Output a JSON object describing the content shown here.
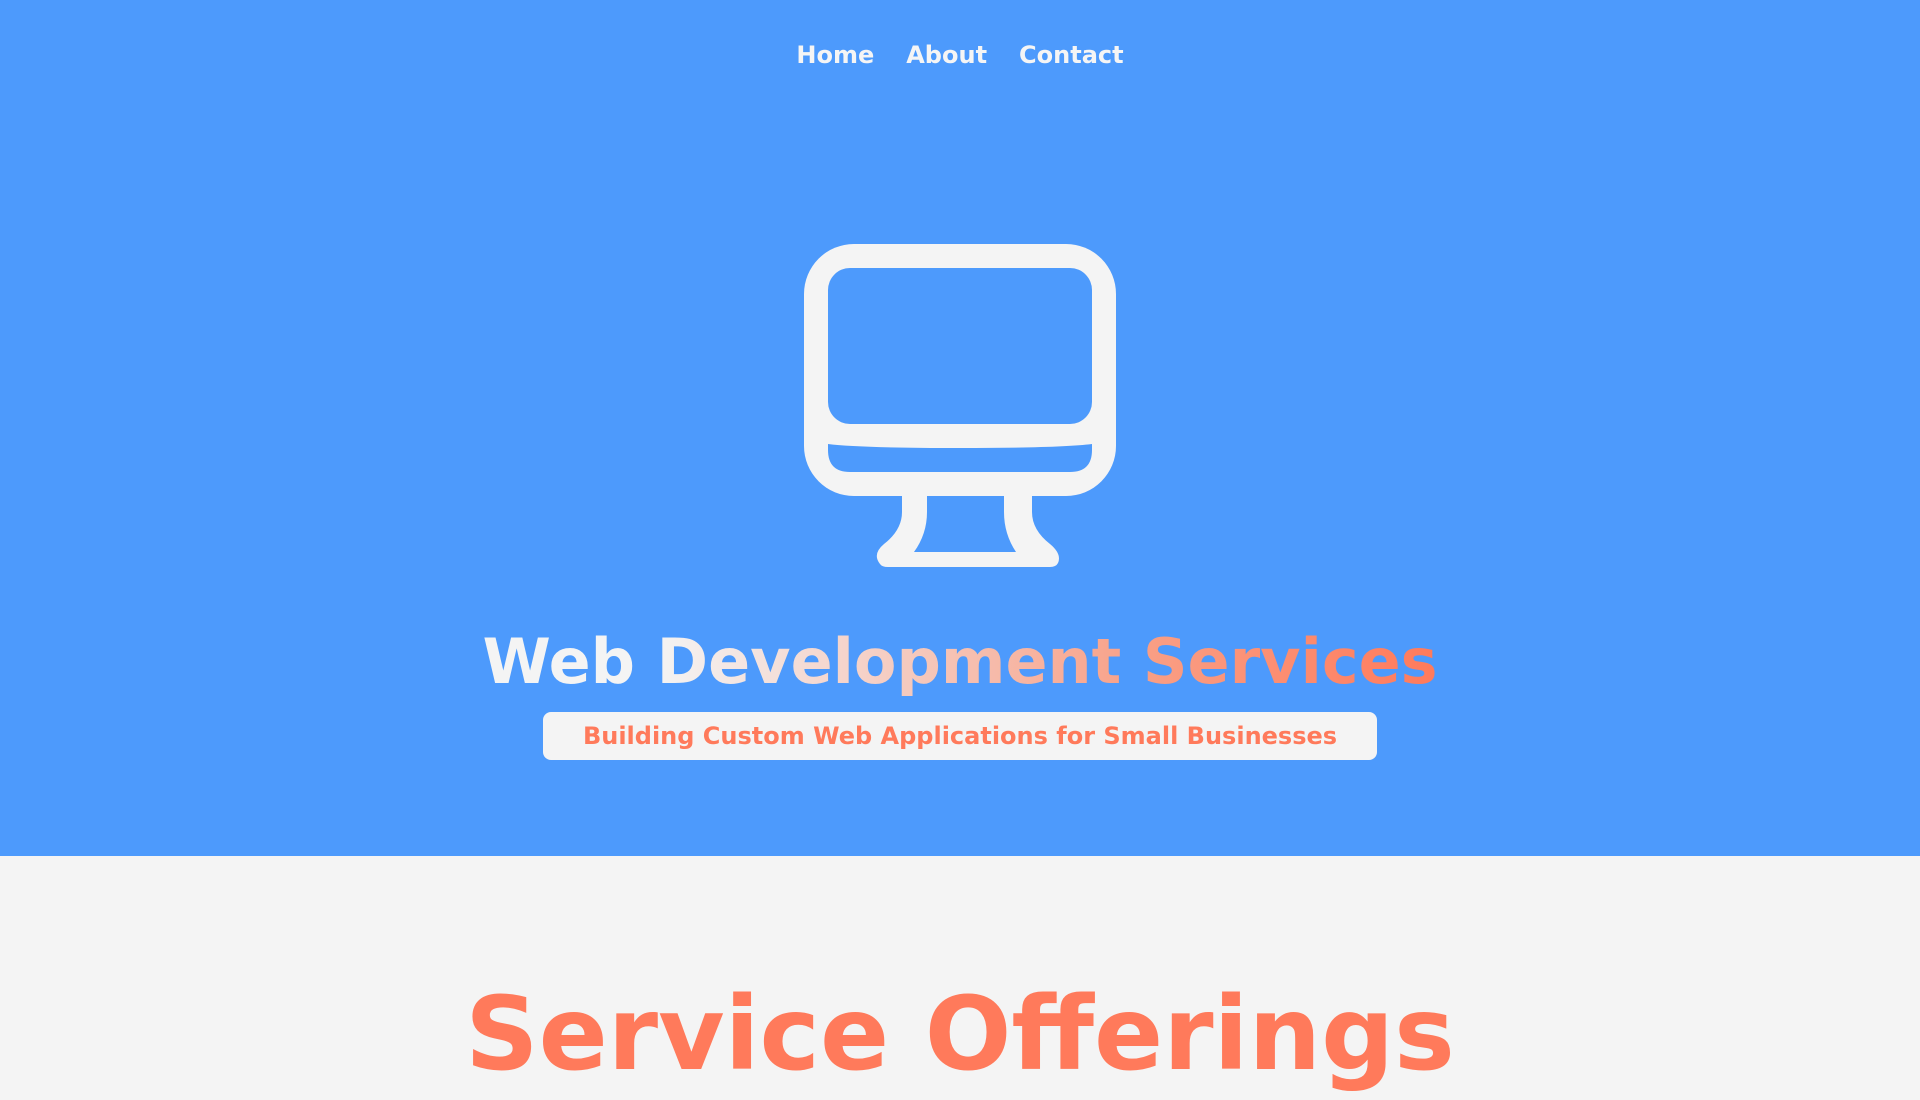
{
  "nav": {
    "items": [
      {
        "label": "Home"
      },
      {
        "label": "About"
      },
      {
        "label": "Contact"
      }
    ]
  },
  "hero": {
    "icon": "monitor-icon",
    "title": "Web Development Services",
    "subtitle": "Building Custom Web Applications for Small Businesses"
  },
  "services": {
    "heading": "Service Offerings"
  },
  "colors": {
    "hero_background": "#4d9afc",
    "accent": "#ff7a5b",
    "light": "#f4f4f4"
  }
}
